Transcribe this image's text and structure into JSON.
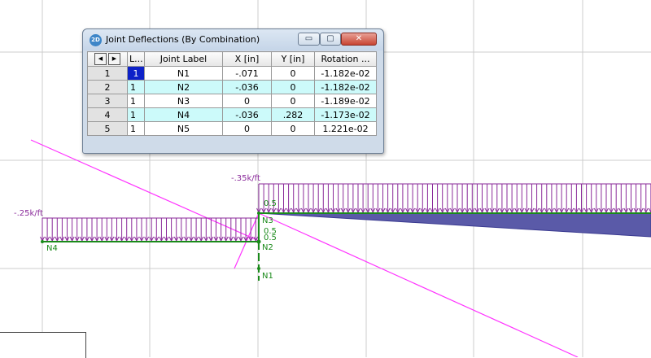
{
  "dialog": {
    "icon_text": "2D",
    "title": "Joint Deflections (By Combination)",
    "buttons": {
      "minimize": "▭",
      "maximize": "▢",
      "close": "✕"
    },
    "columns": [
      "L...",
      "Joint Label",
      "X [in]",
      "Y [in]",
      "Rotation ..."
    ],
    "rows": [
      {
        "num": "1",
        "lc": "1",
        "label": "N1",
        "x": "-.071",
        "y": "0",
        "rot": "-1.182e-02"
      },
      {
        "num": "2",
        "lc": "1",
        "label": "N2",
        "x": "-.036",
        "y": "0",
        "rot": "-1.182e-02"
      },
      {
        "num": "3",
        "lc": "1",
        "label": "N3",
        "x": "0",
        "y": "0",
        "rot": "-1.189e-02"
      },
      {
        "num": "4",
        "lc": "1",
        "label": "N4",
        "x": "-.036",
        "y": ".282",
        "rot": "-1.173e-02"
      },
      {
        "num": "5",
        "lc": "1",
        "label": "N5",
        "x": "0",
        "y": "0",
        "rot": "1.221e-02"
      }
    ]
  },
  "model": {
    "loads": {
      "left": "-.25k/ft",
      "right": "-.35k/ft"
    },
    "nodes": {
      "n1": "N1",
      "n2": "N2",
      "n3": "N3",
      "n4": "N4"
    },
    "annotations": {
      "a1": "0.5",
      "a2": "0.5",
      "a3": "0.5"
    }
  },
  "colors": {
    "grid": "#cccccc",
    "load": "#8a2a9a",
    "member": "#1a8a1a",
    "deflection": "#ff33ff",
    "diagram_fill": "#5a5aa8"
  }
}
